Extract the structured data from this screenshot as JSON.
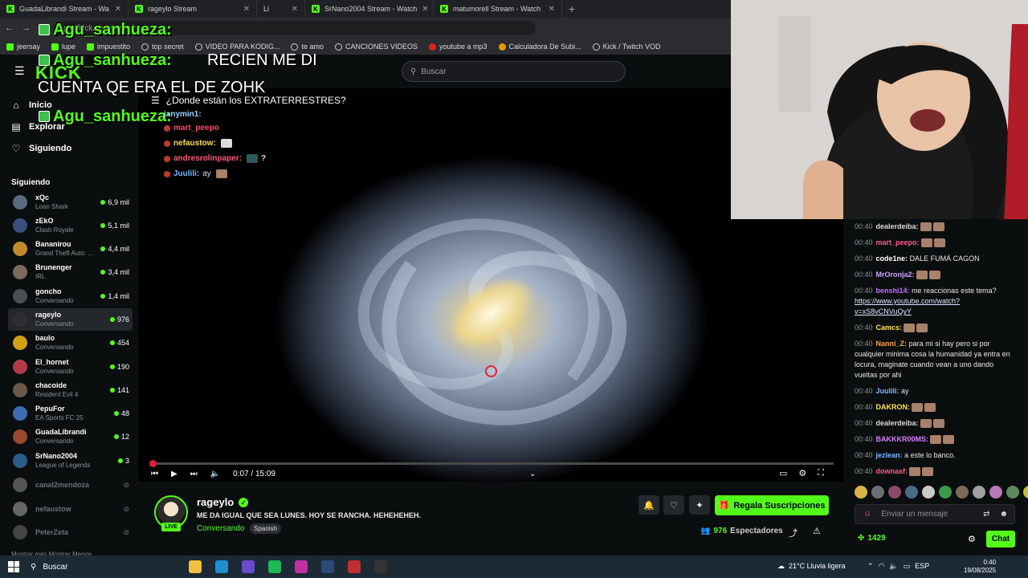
{
  "browser": {
    "tabs": [
      {
        "label": "GuadaLibrandi Stream - Wa"
      },
      {
        "label": "rageylo Stream"
      },
      {
        "label": "Li"
      },
      {
        "label": "SrNano2004 Stream - Watch"
      },
      {
        "label": "matumorell Stream - Watch"
      }
    ],
    "url": "ps://kick.com/rageylo",
    "bookmarks": [
      "jeersay",
      "lupe",
      "impuestito",
      "top secret",
      "VIDEO PARA KODIG...",
      "te amo",
      "CANCIONES VIDEOS",
      "youtube a mp3",
      "Calculadora De Subi...",
      "Kick / Twitch VOD"
    ]
  },
  "header": {
    "logo": "KICK",
    "search_placeholder": "Buscar"
  },
  "sidebar": {
    "nav": [
      {
        "label": "Inicio",
        "icon": "home-icon"
      },
      {
        "label": "Explorar",
        "icon": "compass-icon"
      },
      {
        "label": "Siguiendo",
        "icon": "heart-icon"
      }
    ],
    "following_title": "Siguiendo",
    "channels": [
      {
        "name": "xQc",
        "category": "Loan Shark",
        "viewers": "6,9 mil",
        "color": "#5a6b7d"
      },
      {
        "name": "zEkO",
        "category": "Clash Royale",
        "viewers": "5,1 mil",
        "color": "#3b4f7a"
      },
      {
        "name": "Bananirou",
        "category": "Grand Theft Auto: ...",
        "viewers": "4,4 mil",
        "color": "#c08a2b"
      },
      {
        "name": "Brunenger",
        "category": "IRL",
        "viewers": "3,4 mil",
        "color": "#7a6a5c"
      },
      {
        "name": "goncho",
        "category": "Conversando",
        "viewers": "1,4 mil",
        "color": "#4a4f55"
      },
      {
        "name": "rageylo",
        "category": "Conversando",
        "viewers": "976",
        "color": "#2e2e2e"
      },
      {
        "name": "baulo",
        "category": "Conversando",
        "viewers": "454",
        "color": "#d4a017"
      },
      {
        "name": "El_hornet",
        "category": "Conversando",
        "viewers": "190",
        "color": "#b23a48"
      },
      {
        "name": "chacoide",
        "category": "Resident Evil 4",
        "viewers": "141",
        "color": "#6b5a4a"
      },
      {
        "name": "PepuFor",
        "category": "EA Sports FC 25",
        "viewers": "48",
        "color": "#3d6fb0"
      },
      {
        "name": "GuadaLibrandi",
        "category": "Conversando",
        "viewers": "12",
        "color": "#9a4a2e"
      },
      {
        "name": "SrNano2004",
        "category": "League of Legends",
        "viewers": "3",
        "color": "#2d5d8a"
      },
      {
        "name": "canal2mendoza",
        "category": "",
        "viewers": "",
        "color": "#555555"
      },
      {
        "name": "nefaustow",
        "category": "",
        "viewers": "",
        "color": "#666666"
      },
      {
        "name": "PeterZeta",
        "category": "",
        "viewers": "",
        "color": "#444444"
      }
    ],
    "footer": "Mostrar más    Mostrar Menos"
  },
  "overlay": {
    "big_name": "Agu_sanhueza:",
    "big_msg_1": "RECIEN ME DI",
    "big_msg_2": "CUENTA QE ERA EL DE ZOHK",
    "video_title": "¿Donde están los EXTRATERRESTRES?",
    "chat": [
      {
        "user": "janymin1:",
        "text": "",
        "color": "#9ad0ff"
      },
      {
        "user": "mart_peepo",
        "text": "",
        "color": "#ff4d6d"
      },
      {
        "user": "nefaustow:",
        "text": "",
        "color": "#ffe14d"
      },
      {
        "user": "andresrolinpaper:",
        "text": "?",
        "color": "#ff5c7a"
      },
      {
        "user": "Juulili:",
        "text": "ay",
        "color": "#7ab8ff"
      }
    ]
  },
  "player": {
    "time": "0:07 / 15:09",
    "progress": 0.008
  },
  "stream": {
    "name": "rageylo",
    "live": "LIVE",
    "title": "ME DA IGUAL QUE SEA LUNES. HOY SE RANCHA. HEHEHEHEH.",
    "category": "Conversando",
    "language": "Spanish",
    "sub_button": "Regala Suscripciones",
    "viewers": "976",
    "viewers_label": "Espectadores"
  },
  "chat": {
    "messages": [
      {
        "time": "00:40",
        "user": "dealerdeiba:",
        "text": "",
        "color": "#d9d9d9"
      },
      {
        "time": "00:40",
        "user": "mart_peepo:",
        "text": "",
        "color": "#ff5c8a"
      },
      {
        "time": "00:40",
        "user": "code1ne:",
        "text": "DALE FUMÁ CAGON",
        "color": "#ffffff"
      },
      {
        "time": "00:40",
        "user": "MrOronja2:",
        "text": "",
        "color": "#c8a6ff"
      },
      {
        "time": "00:40",
        "user": "benshi14:",
        "text": "me reaccionas este tema?",
        "link": "https://www.youtube.com/watch?v=xS8vCNVuQyY",
        "color": "#c86bff"
      },
      {
        "time": "00:40",
        "user": "Camcs:",
        "text": "",
        "color": "#ffe14d"
      },
      {
        "time": "00:40",
        "user": "Nanni_Z:",
        "text": "para mi si hay pero si por cualquier minima cosa la humanidad ya entra en locura, maginate cuando vean a uno dando vueltas por ahi",
        "color": "#ff9f43"
      },
      {
        "time": "00:40",
        "user": "Juulili:",
        "text": "ay",
        "color": "#7ab8ff"
      },
      {
        "time": "00:40",
        "user": "DAKRON:",
        "text": "",
        "color": "#ffe14d"
      },
      {
        "time": "00:40",
        "user": "dealerdeiba:",
        "text": "",
        "color": "#d9d9d9"
      },
      {
        "time": "00:40",
        "user": "BAKKKR00MS:",
        "text": "",
        "color": "#d97bff"
      },
      {
        "time": "00:40",
        "user": "jezlean:",
        "text": "a este lo banco.",
        "color": "#7ab8ff"
      },
      {
        "time": "00:40",
        "user": "downasf:",
        "text": "",
        "color": "#ff5c8a"
      }
    ],
    "input_placeholder": "Enviar un mensaje",
    "points": "1429",
    "send_label": "Chat"
  },
  "taskbar": {
    "search": "Buscar",
    "weather": "21°C  Lluvia ligera",
    "lang": "ESP",
    "time": "0:40",
    "date": "19/08/2025"
  }
}
